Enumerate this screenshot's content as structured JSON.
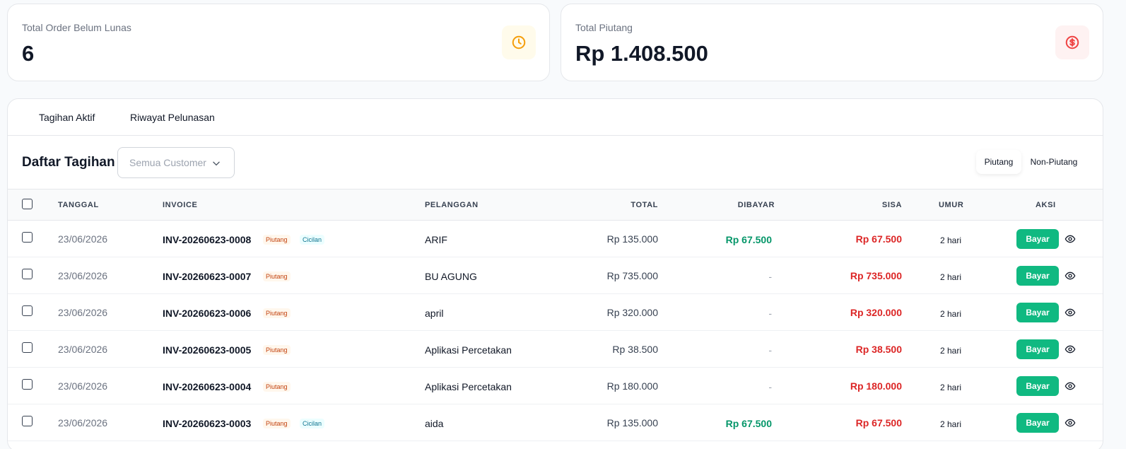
{
  "stats": [
    {
      "label": "Total Order Belum Lunas",
      "value": "6",
      "icon": "clock-icon",
      "color": "#f59e0b",
      "bg": "#fffbeb"
    },
    {
      "label": "Total Piutang",
      "value": "Rp 1.408.500",
      "icon": "dollar-circle-icon",
      "color": "#ef4444",
      "bg": "#fef2f2"
    }
  ],
  "tabs": [
    "Tagihan Aktif",
    "Riwayat Pelunasan"
  ],
  "toolbar": {
    "title": "Daftar Tagihan",
    "customer_select": "Semua Customer",
    "filters": [
      "Piutang",
      "Non-Piutang"
    ]
  },
  "columns": [
    "TANGGAL",
    "INVOICE",
    "PELANGGAN",
    "TOTAL",
    "DIBAYAR",
    "SISA",
    "UMUR",
    "AKSI"
  ],
  "rows": [
    {
      "date": "23/06/2026",
      "invoice": "INV-20260623-0008",
      "badges": [
        "Piutang",
        "Cicilan"
      ],
      "customer": "ARIF",
      "total": "Rp 135.000",
      "paid": "Rp 67.500",
      "remaining": "Rp 67.500",
      "age": "2 hari",
      "action": "Bayar"
    },
    {
      "date": "23/06/2026",
      "invoice": "INV-20260623-0007",
      "badges": [
        "Piutang"
      ],
      "customer": "BU AGUNG",
      "total": "Rp 735.000",
      "paid": "-",
      "remaining": "Rp 735.000",
      "age": "2 hari",
      "action": "Bayar"
    },
    {
      "date": "23/06/2026",
      "invoice": "INV-20260623-0006",
      "badges": [
        "Piutang"
      ],
      "customer": "april",
      "total": "Rp 320.000",
      "paid": "-",
      "remaining": "Rp 320.000",
      "age": "2 hari",
      "action": "Bayar"
    },
    {
      "date": "23/06/2026",
      "invoice": "INV-20260623-0005",
      "badges": [
        "Piutang"
      ],
      "customer": "Aplikasi Percetakan",
      "total": "Rp 38.500",
      "paid": "-",
      "remaining": "Rp 38.500",
      "age": "2 hari",
      "action": "Bayar"
    },
    {
      "date": "23/06/2026",
      "invoice": "INV-20260623-0004",
      "badges": [
        "Piutang"
      ],
      "customer": "Aplikasi Percetakan",
      "total": "Rp 180.000",
      "paid": "-",
      "remaining": "Rp 180.000",
      "age": "2 hari",
      "action": "Bayar"
    },
    {
      "date": "23/06/2026",
      "invoice": "INV-20260623-0003",
      "badges": [
        "Piutang",
        "Cicilan"
      ],
      "customer": "aida",
      "total": "Rp 135.000",
      "paid": "Rp 67.500",
      "remaining": "Rp 67.500",
      "age": "2 hari",
      "action": "Bayar"
    }
  ]
}
